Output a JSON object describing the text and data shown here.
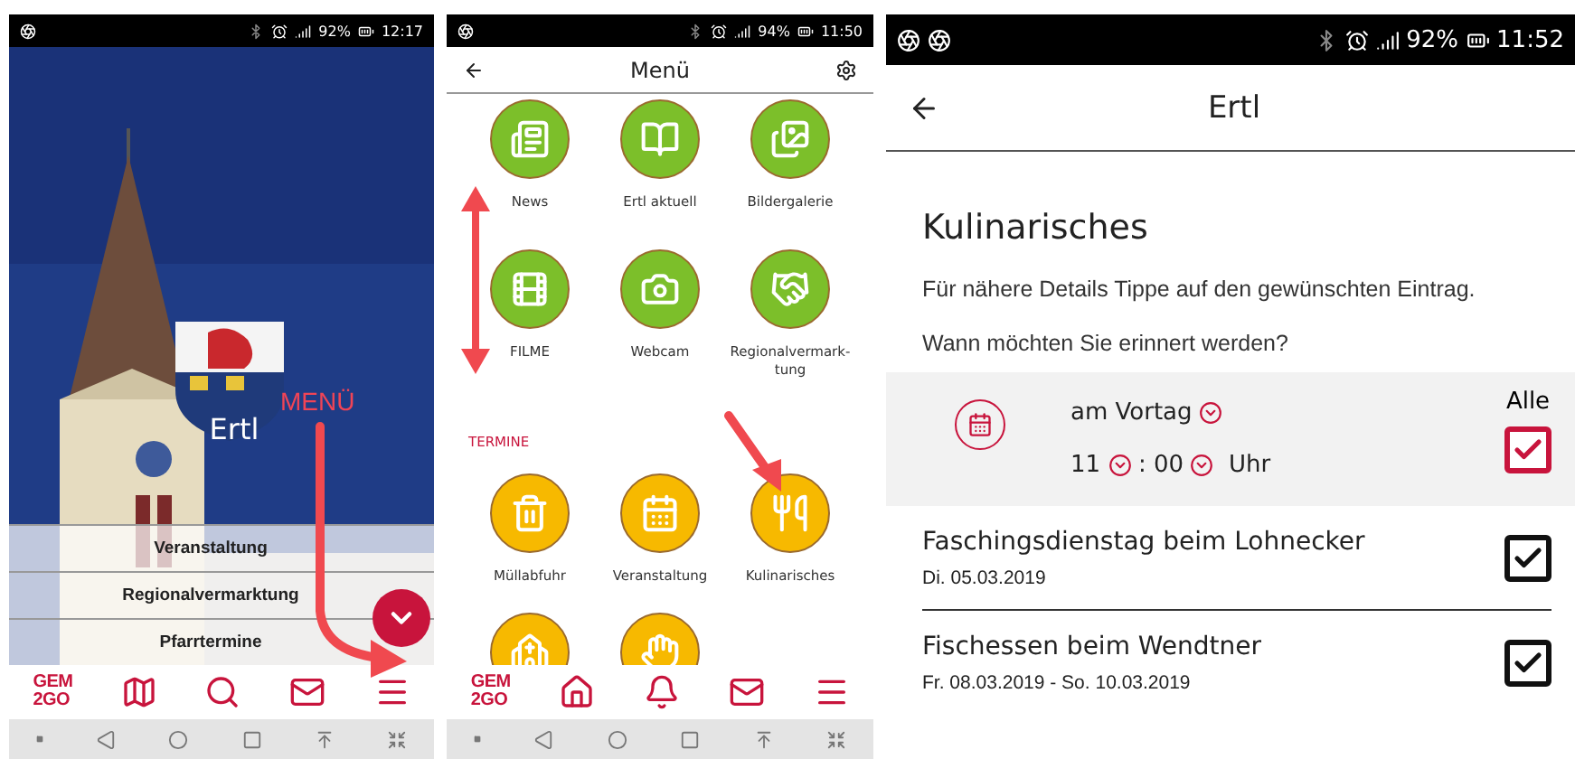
{
  "home_screen": {
    "status_bar": {
      "battery": "92%",
      "time": "12:17"
    },
    "town_name": "Ertl",
    "annotation": "MENÜ",
    "quick_links": [
      "Veranstaltung",
      "Regionalvermarktung",
      "Pfarrtermine"
    ],
    "nav": {
      "logo": [
        "GEM",
        "2GO"
      ],
      "items": [
        {
          "kind": "map"
        },
        {
          "kind": "search"
        },
        {
          "kind": "mail"
        },
        {
          "kind": "menu"
        }
      ]
    }
  },
  "menu_screen": {
    "status_bar": {
      "battery": "94%",
      "time": "11:50"
    },
    "title": "Menü",
    "sections": [
      {
        "items": [
          {
            "kind": "news",
            "label": "News",
            "color": "#7cbf2a"
          },
          {
            "kind": "book",
            "label": "Ertl aktuell",
            "color": "#7cbf2a"
          },
          {
            "kind": "gallery",
            "label": "Bildergalerie",
            "color": "#7cbf2a"
          },
          {
            "kind": "film",
            "label": "FILME",
            "color": "#7cbf2a"
          },
          {
            "kind": "camera",
            "label": "Webcam",
            "color": "#7cbf2a"
          },
          {
            "kind": "handshake",
            "label": "Regionalvermark-tung",
            "color": "#7cbf2a"
          }
        ]
      },
      {
        "heading": "TERMINE",
        "items": [
          {
            "kind": "trash",
            "label": "Müllabfuhr",
            "color": "#f7b900"
          },
          {
            "kind": "calendar",
            "label": "Veranstaltung",
            "color": "#f7b900"
          },
          {
            "kind": "cutlery",
            "label": "Kulinarisches",
            "color": "#f7b900"
          },
          {
            "kind": "church",
            "color": "#f7b900"
          },
          {
            "kind": "hand",
            "color": "#f7b900"
          }
        ]
      }
    ],
    "nav": {
      "logo": [
        "GEM",
        "2GO"
      ],
      "items": [
        {
          "kind": "home"
        },
        {
          "kind": "bell"
        },
        {
          "kind": "mail"
        },
        {
          "kind": "menu"
        }
      ]
    }
  },
  "detail_screen": {
    "status_bar": {
      "battery": "92%",
      "time": "11:52"
    },
    "title": "Ertl",
    "heading": "Kulinarisches",
    "hint": "Für nähere Details Tippe auf den gewünschten Eintrag.",
    "question": "Wann möchten Sie erinnert werden?",
    "reminder": {
      "day": "am Vortag",
      "hour": "11",
      "separator": ":",
      "minute": "00",
      "unit": "Uhr",
      "all_label": "Alle",
      "all_checked": true
    },
    "events": [
      {
        "title": "Faschingsdienstag beim Lohnecker",
        "date": "Di. 05.03.2019",
        "checked": true
      },
      {
        "title": "Fischessen beim Wendtner",
        "date": "Fr. 08.03.2019 - So. 10.03.2019",
        "checked": true
      }
    ]
  }
}
